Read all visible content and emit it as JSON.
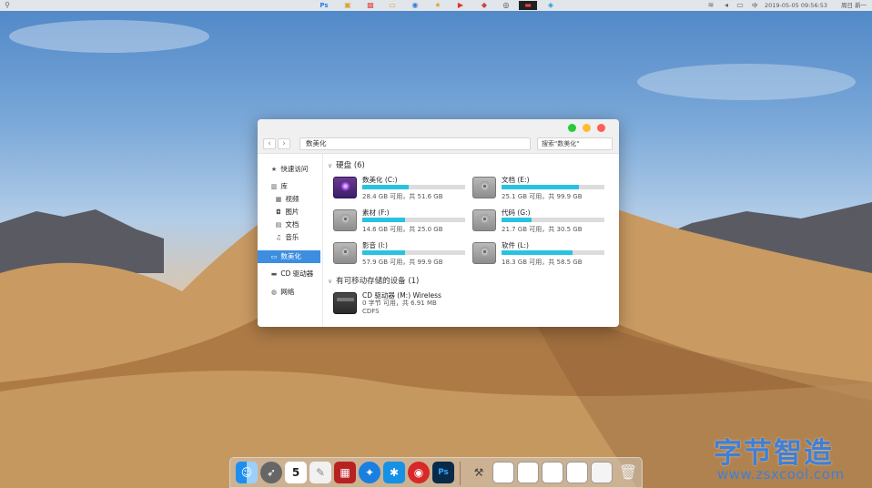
{
  "menubar": {
    "datetime": "2019-05-05  09:56:53",
    "user": "周日  新一",
    "ime": "中",
    "app_icons": [
      "apple-icon",
      "photoshop-icon",
      "illustrator-icon",
      "image-icon",
      "folder-icon",
      "camera-icon",
      "star-icon",
      "youtube-icon",
      "box-icon",
      "chrome-icon",
      "monitor-icon",
      "edge-icon"
    ],
    "status_icons": [
      "wifi-icon",
      "volume-icon",
      "battery-icon"
    ]
  },
  "window": {
    "address": "数美化",
    "search_placeholder": "搜索\"数美化\"",
    "nav_back": "‹",
    "nav_forward": "›"
  },
  "sidebar": {
    "items": [
      {
        "label": "快速访问",
        "icon": "star-icon"
      },
      {
        "label": "库",
        "icon": "library-icon"
      },
      {
        "label": "视频",
        "icon": "video-icon"
      },
      {
        "label": "图片",
        "icon": "picture-icon"
      },
      {
        "label": "文档",
        "icon": "document-icon"
      },
      {
        "label": "音乐",
        "icon": "music-icon"
      },
      {
        "label": "数美化",
        "icon": "monitor-icon",
        "active": true
      },
      {
        "label": "CD 驱动器",
        "icon": "cd-drive-icon"
      },
      {
        "label": "网络",
        "icon": "network-icon"
      }
    ]
  },
  "content": {
    "hard_disks_title": "硬盘 (6)",
    "removable_title": "有可移动存储的设备 (1)",
    "drives": [
      {
        "name": "数美化 (C:)",
        "free": "28.4 GB 可用，共 51.6 GB",
        "used_fraction": 0.45,
        "icon": "system-drive-icon"
      },
      {
        "name": "文档 (E:)",
        "free": "25.1 GB 可用，共 99.9 GB",
        "used_fraction": 0.75,
        "icon": "hard-drive-icon"
      },
      {
        "name": "素材 (F:)",
        "free": "14.6 GB 可用，共 25.0 GB",
        "used_fraction": 0.42,
        "icon": "hard-drive-icon"
      },
      {
        "name": "代码 (G:)",
        "free": "21.7 GB 可用，共 30.5 GB",
        "used_fraction": 0.29,
        "icon": "hard-drive-icon"
      },
      {
        "name": "影音 (I:)",
        "free": "57.9 GB 可用，共 99.9 GB",
        "used_fraction": 0.42,
        "icon": "hard-drive-icon"
      },
      {
        "name": "软件 (L:)",
        "free": "18.3 GB 可用，共 58.5 GB",
        "used_fraction": 0.69,
        "icon": "hard-drive-icon"
      }
    ],
    "cd_drive": {
      "name": "CD 驱动器 (M:) Wireless",
      "size": "0 字节 可用，共 6.91 MB",
      "fs": "CDFS",
      "icon": "cd-drive-icon"
    }
  },
  "dock": {
    "items": [
      "finder-icon",
      "launchpad-icon",
      "calendar-icon",
      "notes-icon",
      "photo-booth-icon",
      "safari-icon",
      "app-store-icon",
      "netease-music-icon",
      "photoshop-icon",
      "utilities-icon",
      "window-thumb-1",
      "window-thumb-2",
      "window-thumb-3",
      "window-thumb-4",
      "window-thumb-5",
      "trash-icon"
    ],
    "calendar_day": "5"
  },
  "watermark": {
    "title": "字节智造",
    "url": "www.zsxcool.com"
  },
  "colors": {
    "accent": "#3d8ee0",
    "bar_fill": "#28c3e0",
    "traffic_red": "#ff5f57",
    "traffic_yellow": "#fdbc2e",
    "traffic_green": "#29c940"
  }
}
